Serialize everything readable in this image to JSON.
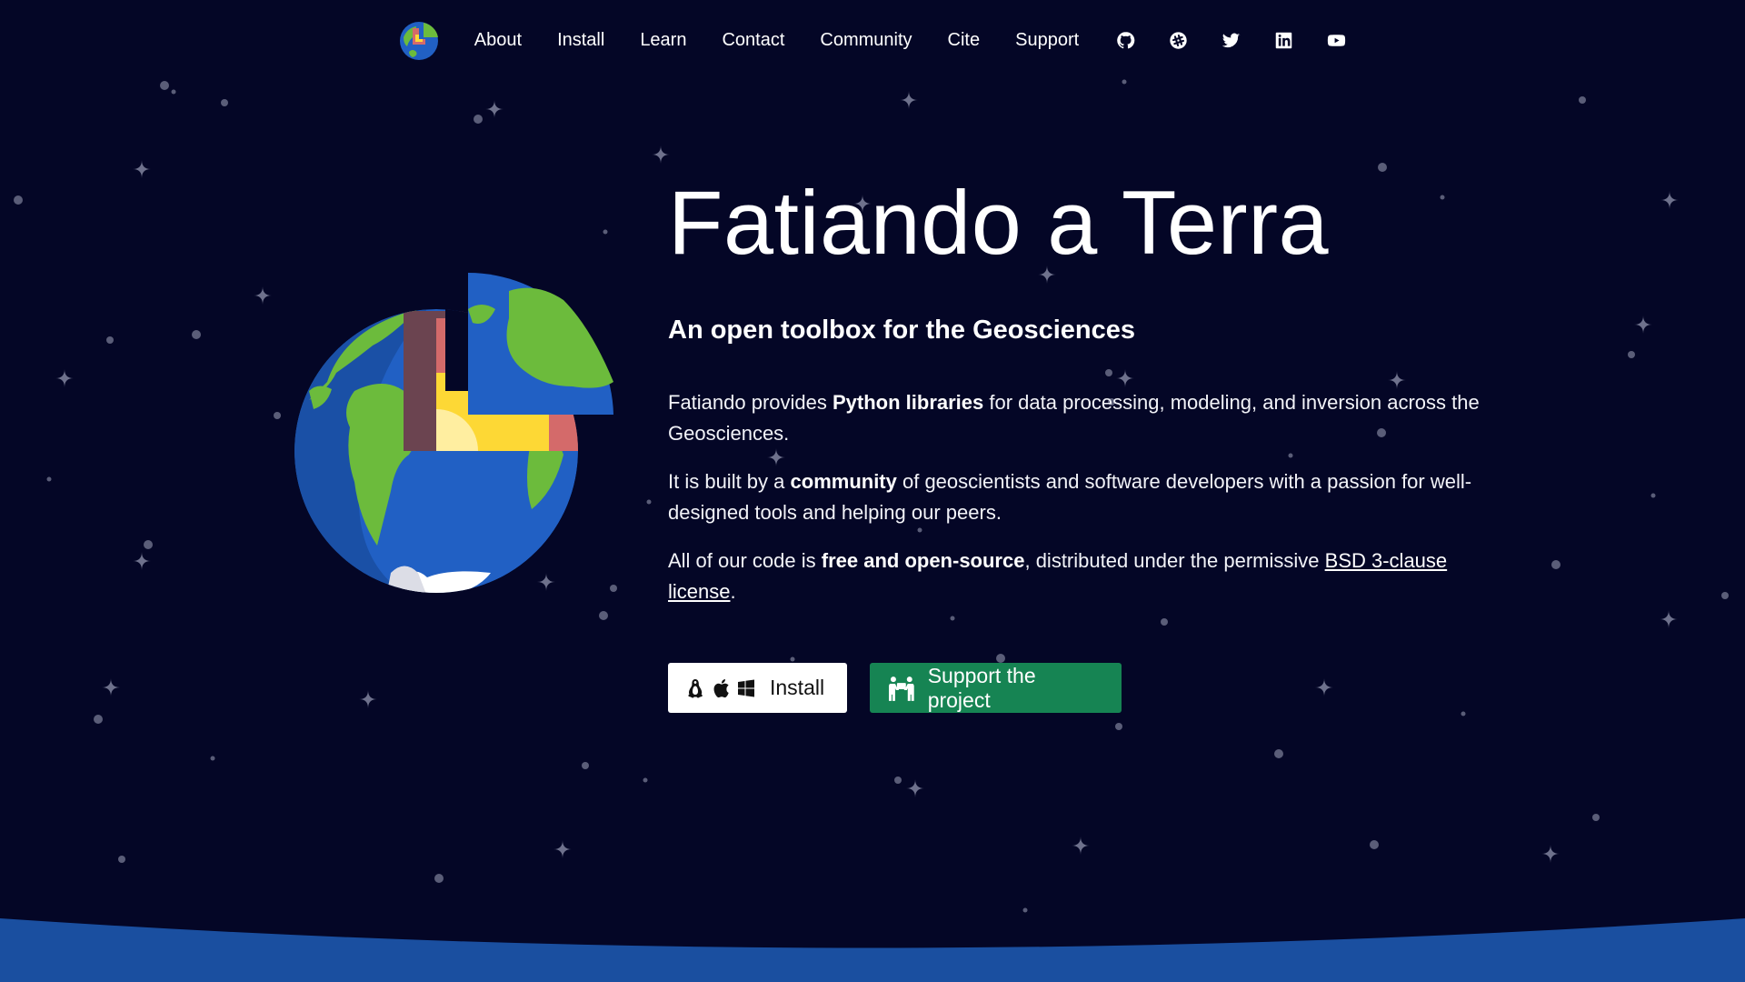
{
  "nav": {
    "links": [
      "About",
      "Install",
      "Learn",
      "Contact",
      "Community",
      "Cite",
      "Support"
    ],
    "social_icons": [
      "github-icon",
      "slack-icon",
      "twitter-icon",
      "linkedin-icon",
      "youtube-icon"
    ]
  },
  "hero": {
    "title": "Fatiando a Terra",
    "tagline": "An open toolbox for the Geosciences",
    "p1": {
      "before": "Fatiando provides ",
      "bold": "Python libraries",
      "after": " for data processing, modeling, and inversion across the Geosciences."
    },
    "p2": {
      "before": "It is built by a ",
      "bold": "community",
      "after": " of geoscientists and software developers with a passion for well-designed tools and helping our peers."
    },
    "p3": {
      "before": "All of our code is ",
      "bold": "free and open-source",
      "middle": ", distributed under the permissive ",
      "link": "BSD 3-clause license",
      "after": "."
    }
  },
  "buttons": {
    "install_label": "Install",
    "install_icons": [
      "linux-icon",
      "apple-icon",
      "windows-icon"
    ],
    "support_label": "Support the project",
    "support_icon": "people-carry-icon"
  },
  "colors": {
    "background": "#040626",
    "support_button": "#168453",
    "horizon": "#1a4fa0",
    "globe_ocean": "#2160c4",
    "globe_land": "#6cbb3c"
  }
}
